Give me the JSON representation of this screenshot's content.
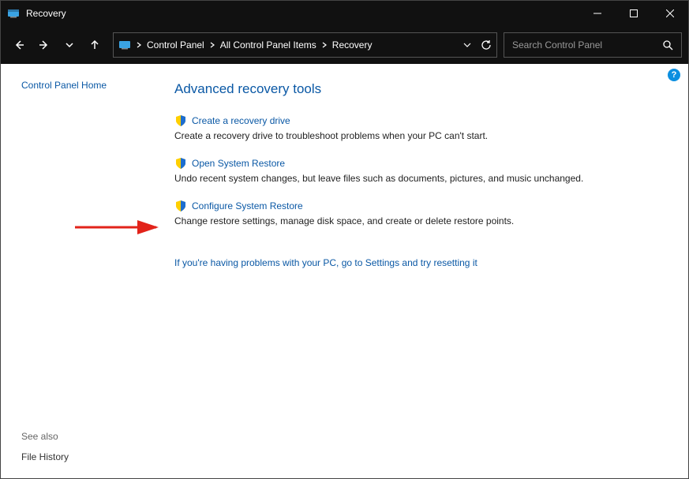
{
  "window": {
    "title": "Recovery"
  },
  "breadcrumb": {
    "items": [
      "Control Panel",
      "All Control Panel Items",
      "Recovery"
    ]
  },
  "search": {
    "placeholder": "Search Control Panel"
  },
  "sidebar": {
    "home": "Control Panel Home",
    "seealso_label": "See also",
    "file_history": "File History"
  },
  "main": {
    "heading": "Advanced recovery tools",
    "tools": [
      {
        "link": "Create a recovery drive",
        "desc": "Create a recovery drive to troubleshoot problems when your PC can't start."
      },
      {
        "link": "Open System Restore",
        "desc": "Undo recent system changes, but leave files such as documents, pictures, and music unchanged."
      },
      {
        "link": "Configure System Restore",
        "desc": "Change restore settings, manage disk space, and create or delete restore points."
      }
    ],
    "extra_link": "If you're having problems with your PC, go to Settings and try resetting it"
  },
  "help": {
    "label": "?"
  }
}
